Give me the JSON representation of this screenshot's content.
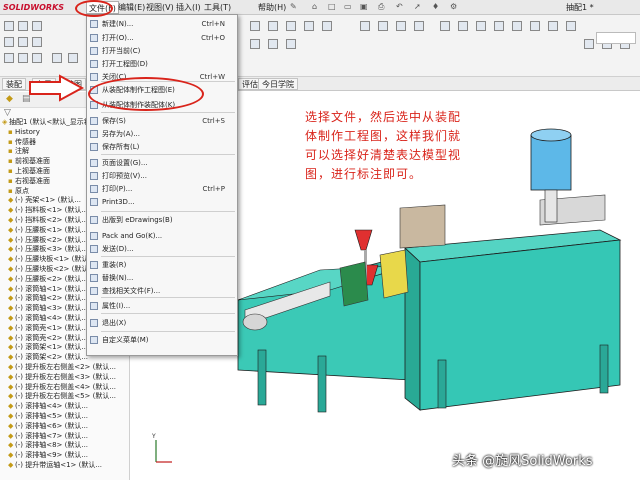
{
  "app": {
    "logo": "SOLIDWORKS",
    "doc_name": "抽配1 *"
  },
  "menubar": {
    "file": "文件(F)",
    "edit": "编辑(E)",
    "view": "视图(V)",
    "insert": "插入(I)",
    "tools": "工具(T)",
    "help": "帮助(H)"
  },
  "command_tabs": [
    "装配",
    "布局",
    "草图",
    "评估"
  ],
  "extra_tab": "今日学院",
  "file_menu": {
    "items": [
      {
        "label": "新建(N)...",
        "shortcut": "Ctrl+N"
      },
      {
        "label": "打开(O)...",
        "shortcut": "Ctrl+O"
      },
      {
        "label": "打开当前(C)",
        "shortcut": ""
      },
      {
        "label": "打开工程图(D)",
        "shortcut": ""
      },
      {
        "label": "关闭(C)",
        "shortcut": "Ctrl+W"
      },
      {
        "label": "从装配体制作工程图(E)",
        "shortcut": ""
      },
      {
        "label": "从装配体制作装配体(K)",
        "shortcut": ""
      },
      {
        "label": "保存(S)",
        "shortcut": "Ctrl+S"
      },
      {
        "label": "另存为(A)...",
        "shortcut": ""
      },
      {
        "label": "保存所有(L)",
        "shortcut": ""
      },
      {
        "label": "页面设置(G)...",
        "shortcut": ""
      },
      {
        "label": "打印预览(V)...",
        "shortcut": ""
      },
      {
        "label": "打印(P)...",
        "shortcut": "Ctrl+P"
      },
      {
        "label": "Print3D...",
        "shortcut": ""
      },
      {
        "label": "出版到 eDrawings(B)",
        "shortcut": ""
      },
      {
        "label": "Pack and Go(K)...",
        "shortcut": ""
      },
      {
        "label": "发送(D)...",
        "shortcut": ""
      },
      {
        "label": "重装(R)",
        "shortcut": ""
      },
      {
        "label": "替换(N)...",
        "shortcut": ""
      },
      {
        "label": "查找相关文件(F)...",
        "shortcut": ""
      },
      {
        "label": "属性(I)...",
        "shortcut": ""
      },
      {
        "label": "退出(X)",
        "shortcut": ""
      },
      {
        "label": "自定义菜单(M)",
        "shortcut": ""
      }
    ]
  },
  "tree": {
    "root": "抽配1 (默认<默认_显示状态-1>)",
    "items": [
      "History",
      "传感器",
      "注解",
      "前视基准面",
      "上视基准面",
      "右视基准面",
      "原点",
      "(-) 壳架<1> (默认...",
      "(-) 挡料板<1> (默认...",
      "(-) 挡料板<2> (默认...",
      "(-) 压腰板<1> (默认...",
      "(-) 压腰板<2> (默认...",
      "(-) 压腰板<3> (默认...",
      "(-) 压腰块板<1> (默认...",
      "(-) 压腰块板<2> (默认...",
      "(-) 压腰板<2> (默认...",
      "(-) 滚筒轴<1> (默认...",
      "(-) 滚筒轴<2> (默认...",
      "(-) 滚筒轴<3> (默认...",
      "(-) 滚筒轴<4> (默认...",
      "(-) 滚筒壳<1> (默认...",
      "(-) 滚筒壳<2> (默认...",
      "(-) 滚筒架<1> (默认...",
      "(-) 滚筒架<2> (默认...",
      "(-) 提升板左右侧盖<2> (默认...",
      "(-) 提升板左右侧盖<3> (默认...",
      "(-) 提升板左右侧盖<4> (默认...",
      "(-) 提升板左右侧盖<5> (默认...",
      "(-) 滚排轴<4> (默认...",
      "(-) 滚排轴<5> (默认...",
      "(-) 滚排轴<6> (默认...",
      "(-) 滚排轴<7> (默认...",
      "(-) 滚排轴<8> (默认...",
      "(-) 滚排轴<9> (默认...",
      "(-) 提升带运轴<1> (默认..."
    ]
  },
  "annotation": "选择文件，然后选中从装配体制作工程图，这样我们就可以选择好清楚表达模型视图，进行标注即可。",
  "watermark": "头条 @旋风SolidWorks",
  "colors": {
    "machine_body": "#35c7b5",
    "hopper": "#5db8e8",
    "annotation": "#d9241b",
    "logo": "#c8102e"
  }
}
